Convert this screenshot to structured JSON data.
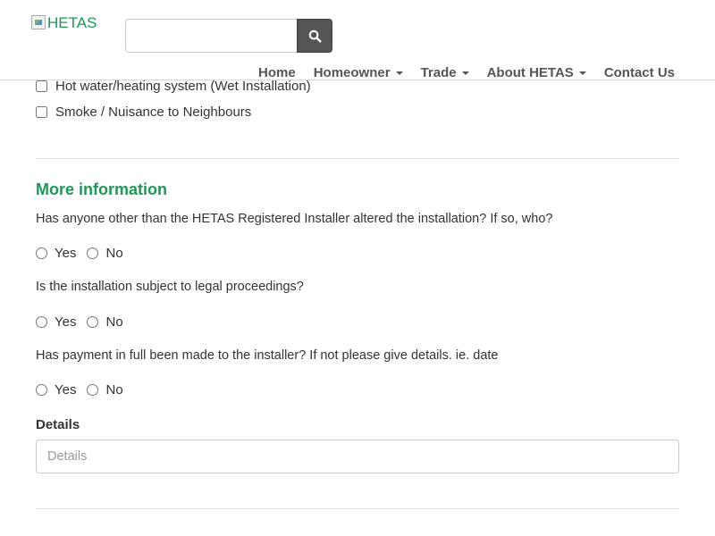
{
  "header": {
    "logo_alt": "HETAS",
    "search": {
      "value": "",
      "placeholder": ""
    },
    "nav": [
      {
        "label": "Home",
        "dropdown": false
      },
      {
        "label": "Homeowner",
        "dropdown": true
      },
      {
        "label": "Trade",
        "dropdown": true
      },
      {
        "label": "About HETAS",
        "dropdown": true
      },
      {
        "label": "Contact Us",
        "dropdown": false
      }
    ]
  },
  "checkboxes": [
    {
      "label": "Hot water/heating system (Wet Installation)",
      "checked": false
    },
    {
      "label": "Smoke / Nuisance to Neighbours",
      "checked": false
    }
  ],
  "more_info": {
    "title": "More information",
    "questions": [
      {
        "text": "Has anyone other than the HETAS Registered Installer altered the installation? If so, who?",
        "options": [
          "Yes",
          "No"
        ]
      },
      {
        "text": "Is the installation subject to legal proceedings?",
        "options": [
          "Yes",
          "No"
        ]
      },
      {
        "text": "Has payment in full been made to the installer? If not please give details. ie. date",
        "options": [
          "Yes",
          "No"
        ]
      }
    ],
    "details": {
      "label": "Details",
      "placeholder": "Details",
      "value": ""
    }
  },
  "colors": {
    "accent": "#1a9a53",
    "search_button": "#555555"
  }
}
